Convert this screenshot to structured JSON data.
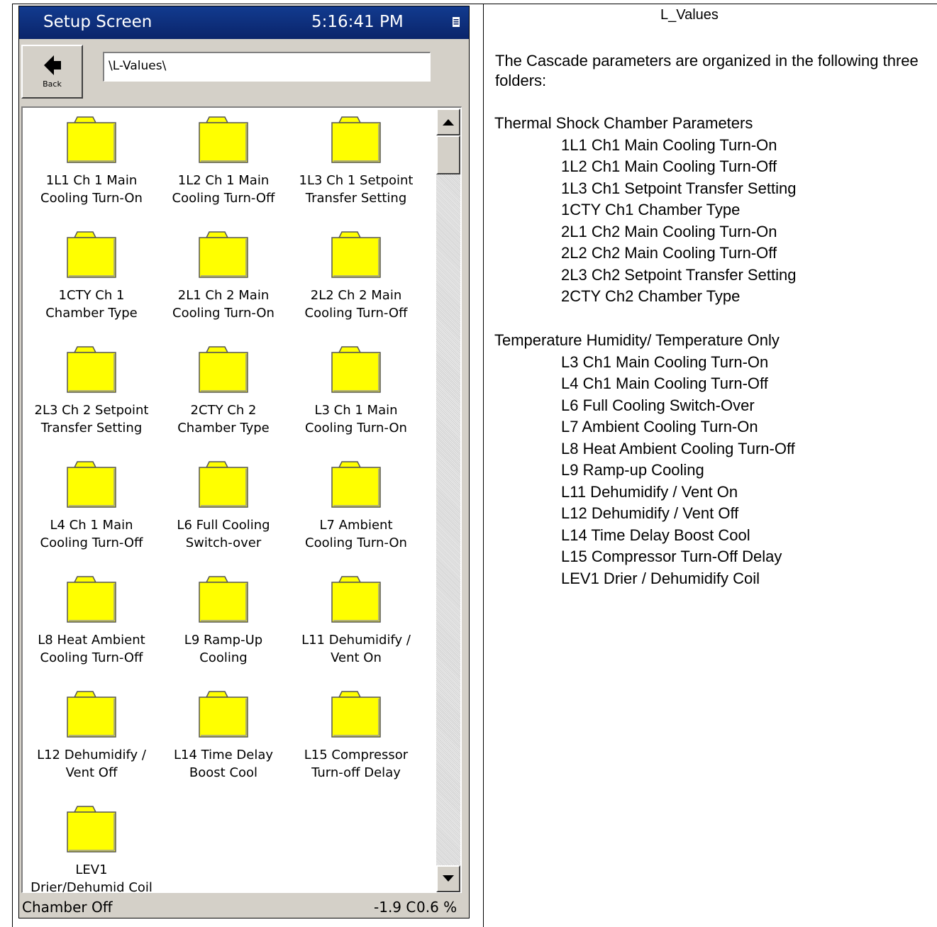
{
  "device": {
    "title": "Setup Screen",
    "clock": "5:16:41 PM",
    "back_label": "Back",
    "path": "\\L-Values\\",
    "folders": [
      [
        "1L1 Ch 1 Main",
        "Cooling Turn-On"
      ],
      [
        "1L2 Ch 1 Main",
        "Cooling Turn-Off"
      ],
      [
        "1L3 Ch 1 Setpoint",
        "Transfer Setting"
      ],
      [
        "1CTY Ch 1",
        "Chamber Type"
      ],
      [
        "2L1 Ch 2 Main",
        "Cooling Turn-On"
      ],
      [
        "2L2 Ch 2 Main",
        "Cooling Turn-Off"
      ],
      [
        "2L3 Ch 2 Setpoint",
        "Transfer Setting"
      ],
      [
        "2CTY Ch 2",
        "Chamber Type"
      ],
      [
        "L3 Ch 1 Main",
        "Cooling Turn-On"
      ],
      [
        "L4 Ch 1 Main",
        "Cooling Turn-Off"
      ],
      [
        "L6 Full Cooling",
        "Switch-over"
      ],
      [
        "L7 Ambient",
        "Cooling Turn-On"
      ],
      [
        "L8 Heat Ambient",
        "Cooling Turn-Off"
      ],
      [
        "L9 Ramp-Up",
        "Cooling"
      ],
      [
        "L11 Dehumidify /",
        "Vent On"
      ],
      [
        "L12 Dehumidify /",
        "Vent Off"
      ],
      [
        "L14 Time Delay",
        "Boost Cool"
      ],
      [
        "L15 Compressor",
        "Turn-off Delay"
      ],
      [
        "LEV1",
        "Drier/Dehumid Coil"
      ]
    ],
    "status": "Chamber Off",
    "temperature": "-1.9 C",
    "humidity": "0.6 %"
  },
  "doc": {
    "title": "L_Values",
    "intro": "The Cascade parameters are organized in the following three folders:",
    "sections": [
      {
        "heading": "Thermal Shock Chamber Parameters",
        "items": [
          "1L1 Ch1 Main Cooling Turn-On",
          "1L2 Ch1 Main Cooling Turn-Off",
          "1L3 Ch1 Setpoint Transfer Setting",
          "1CTY Ch1 Chamber Type",
          "2L1 Ch2 Main Cooling Turn-On",
          "2L2 Ch2 Main Cooling Turn-Off",
          "2L3 Ch2 Setpoint Transfer Setting",
          "2CTY Ch2 Chamber Type"
        ]
      },
      {
        "heading": "Temperature Humidity/ Temperature Only",
        "items": [
          "L3 Ch1 Main Cooling Turn-On",
          "L4 Ch1 Main Cooling Turn-Off",
          "L6 Full Cooling Switch-Over",
          "L7 Ambient Cooling Turn-On",
          "L8 Heat Ambient Cooling Turn-Off",
          "L9 Ramp-up Cooling",
          "L11 Dehumidify / Vent On",
          "L12 Dehumidify / Vent Off",
          "L14 Time Delay Boost Cool",
          "L15 Compressor Turn-Off Delay",
          "LEV1 Drier / Dehumidify Coil"
        ]
      }
    ]
  },
  "colors": {
    "titlebar": "#0a246a",
    "folder_fill": "#ffff00",
    "window_face": "#d4d0c8"
  },
  "icons": {
    "folder": "folder-icon",
    "back": "back-arrow-icon",
    "scroll_up": "scroll-up-arrow-icon",
    "scroll_down": "scroll-down-arrow-icon"
  }
}
